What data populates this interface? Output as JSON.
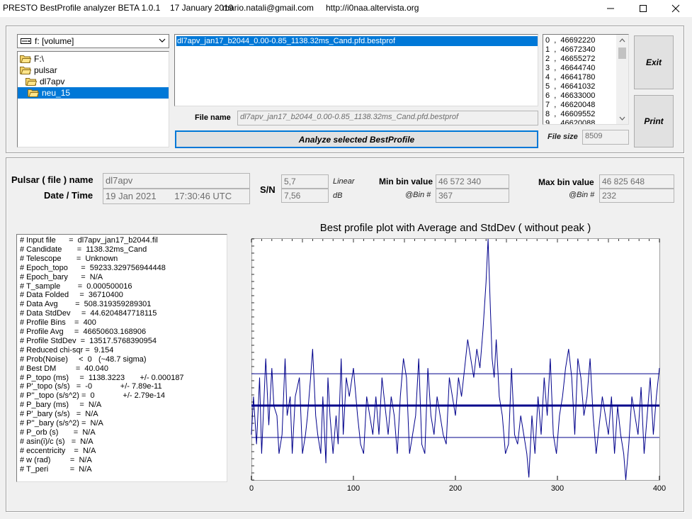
{
  "titlebar": {
    "app": "PRESTO BestProfile analyzer BETA 1.0.1",
    "date": "17 January 2019",
    "email": "mario.natali@gmail.com",
    "url": "http://i0naa.altervista.org"
  },
  "drive": {
    "value": "f: [volume]"
  },
  "tree": [
    "F:\\",
    "pulsar",
    "dl7apv",
    "neu_15"
  ],
  "file_list": {
    "selected": "dl7apv_jan17_b2044_0.00-0.85_1138.32ms_Cand.pfd.bestprof"
  },
  "file_name": {
    "label": "File name",
    "value": "dl7apv_jan17_b2044_0.00-0.85_1138.32ms_Cand.pfd.bestprof"
  },
  "analyze_label": "Analyze selected BestProfile",
  "values_list": [
    "0  ,  46692220",
    "1  ,  46672340",
    "2  ,  46655272",
    "3  ,  46644740",
    "4  ,  46641780",
    "5  ,  46641032",
    "6  ,  46633000",
    "7  ,  46620048",
    "8  ,  46609552",
    "9  ,  46620088"
  ],
  "file_size": {
    "label": "File size",
    "value": "8509"
  },
  "exit_label": "Exit",
  "print_label": "Print",
  "pulsar": {
    "name_label": "Pulsar ( file ) name",
    "name_value": "dl7apv",
    "datetime_label": "Date / Time",
    "date_value": "19 Jan 2021",
    "time_value": "17:30:46  UTC"
  },
  "sn": {
    "label": "S/N",
    "linear": "5,7",
    "linear_unit": "Linear",
    "db": "7,56",
    "db_unit": "dB"
  },
  "min_bin": {
    "label": "Min bin value",
    "value": "46 572 340",
    "bin_label": "@Bin #",
    "bin": "367"
  },
  "max_bin": {
    "label": "Max bin value",
    "value": "46 825 648",
    "bin_label": "@Bin #",
    "bin": "232"
  },
  "info": [
    "# Input file      =  dl7apv_jan17_b2044.fil",
    "# Candidate       =  1138.32ms_Cand",
    "# Telescope       =  Unknown",
    "# Epoch_topo      =  59233.329756944448",
    "# Epoch_bary      =  N/A",
    "# T_sample        =  0.000500016",
    "# Data Folded     =  36710400",
    "# Data Avg        =  508.319359289301",
    "# Data StdDev     =  44.6204847718115",
    "# Profile Bins    =  400",
    "# Profile Avg     =  46650603.168906",
    "# Profile StdDev  =  13517.5768390954",
    "# Reduced chi-sqr =  9.154",
    "# Prob(Noise)     <  0   (~48.7 sigma)",
    "# Best DM         =  40.040",
    "# P_topo (ms)     =  1138.3223       +/- 0.000187",
    "# P'_topo (s/s)   =  -0             +/- 7.89e-11",
    "# P''_topo (s/s^2) =  0             +/- 2.79e-14",
    "# P_bary (ms)     =  N/A",
    "# P'_bary (s/s)   =  N/A",
    "# P''_bary (s/s^2) =  N/A",
    "# P_orb (s)       =  N/A",
    "# asin(i)/c (s)   =  N/A",
    "# eccentricity    =  N/A",
    "# w (rad)         =  N/A",
    "# T_peri          =  N/A"
  ],
  "colors": {
    "selection": "#0078d7",
    "plot_line": "#00008b"
  },
  "chart_data": {
    "type": "line",
    "title": "Best profile plot with  Average and StdDev ( without peak )",
    "xlim": [
      0,
      400
    ],
    "ylim": [
      46572340,
      46825648
    ],
    "xticks": [
      0,
      100,
      200,
      300,
      400
    ],
    "average": 46650603,
    "std_upper": 46684000,
    "std_lower": 46617000,
    "series": [
      {
        "x": [
          0,
          2,
          5,
          8,
          10,
          14,
          17,
          20,
          22,
          25,
          27,
          30,
          33,
          35,
          38,
          40,
          43,
          47,
          50,
          53,
          55,
          58,
          60,
          63,
          65,
          68,
          70,
          73,
          75,
          77,
          80,
          83,
          85,
          88,
          90,
          93,
          96,
          100,
          104,
          107,
          110,
          113,
          116,
          119,
          122,
          125,
          128,
          131,
          134,
          137,
          140,
          143,
          146,
          149,
          152,
          155,
          158,
          161,
          164,
          167,
          170,
          173,
          176,
          179,
          182,
          185,
          188,
          191,
          194,
          197,
          200,
          203,
          206,
          209,
          212,
          215,
          218,
          221,
          224,
          227,
          230,
          232,
          234,
          236,
          238,
          240,
          243,
          246,
          249,
          252,
          255,
          258,
          261,
          264,
          267,
          270,
          272,
          275,
          278,
          281,
          284,
          287,
          290,
          293,
          296,
          299,
          302,
          305,
          308,
          311,
          314,
          317,
          320,
          323,
          326,
          329,
          332,
          335,
          338,
          341,
          344,
          347,
          350,
          353,
          356,
          359,
          362,
          365,
          367,
          370,
          373,
          376,
          379,
          382,
          385,
          388,
          391,
          394,
          397,
          400
        ],
        "y": [
          46620000,
          46660000,
          46610000,
          46680000,
          46600000,
          46700000,
          46630000,
          46690000,
          46650000,
          46640000,
          46600000,
          46620000,
          46700000,
          46640000,
          46660000,
          46600000,
          46660000,
          46680000,
          46600000,
          46620000,
          46640000,
          46680000,
          46710000,
          46640000,
          46620000,
          46600000,
          46660000,
          46590000,
          46680000,
          46640000,
          46600000,
          46640000,
          46610000,
          46700000,
          46620000,
          46680000,
          46660000,
          46690000,
          46640000,
          46610000,
          46600000,
          46660000,
          46640000,
          46620000,
          46660000,
          46620000,
          46680000,
          46650000,
          46620000,
          46660000,
          46640000,
          46600000,
          46660000,
          46700000,
          46680000,
          46600000,
          46620000,
          46640000,
          46700000,
          46610000,
          46600000,
          46690000,
          46640000,
          46620000,
          46660000,
          46640000,
          46620000,
          46610000,
          46680000,
          46660000,
          46640000,
          46680000,
          46660000,
          46690000,
          46720000,
          46700000,
          46680000,
          46710000,
          46690000,
          46730000,
          46780000,
          46825648,
          46760000,
          46700000,
          46680000,
          46720000,
          46660000,
          46640000,
          46600000,
          46610000,
          46690000,
          46620000,
          46610000,
          46640000,
          46620000,
          46600000,
          46575000,
          46640000,
          46600000,
          46660000,
          46620000,
          46680000,
          46640000,
          46700000,
          46620000,
          46600000,
          46640000,
          46660000,
          46690000,
          46710000,
          46680000,
          46620000,
          46700000,
          46680000,
          46640000,
          46660000,
          46700000,
          46640000,
          46600000,
          46630000,
          46660000,
          46640000,
          46620000,
          46660000,
          46600000,
          46650000,
          46620000,
          46600000,
          46572340,
          46610000,
          46660000,
          46640000,
          46620000,
          46670000,
          46600000,
          46640000,
          46680000,
          46620000,
          46660000,
          46690000
        ]
      }
    ]
  }
}
